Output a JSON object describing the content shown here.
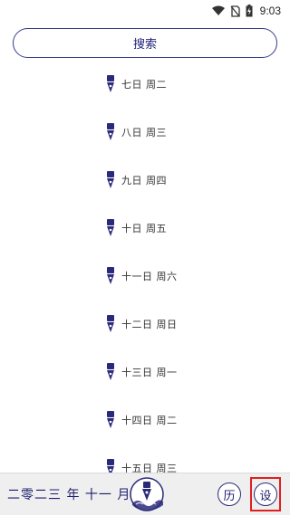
{
  "status_bar": {
    "time": "9:03",
    "icons": [
      "wifi-icon",
      "no-sim-icon",
      "battery-charging-icon"
    ]
  },
  "search": {
    "label": "搜索"
  },
  "dates": [
    {
      "label": "七日 周二"
    },
    {
      "label": "八日 周三"
    },
    {
      "label": "九日 周四"
    },
    {
      "label": "十日 周五"
    },
    {
      "label": "十一日 周六"
    },
    {
      "label": "十二日 周日"
    },
    {
      "label": "十三日 周一"
    },
    {
      "label": "十四日 周二"
    },
    {
      "label": "十五日 周三"
    }
  ],
  "bottom_bar": {
    "year_month": "二零二三 年 十一 月",
    "history_label": "历",
    "settings_label": "设",
    "emblem_icon": "ink-wave-seal-icon"
  },
  "colors": {
    "accent": "#2a2a7a",
    "highlight": "#e02020",
    "bar": "#efefef"
  }
}
